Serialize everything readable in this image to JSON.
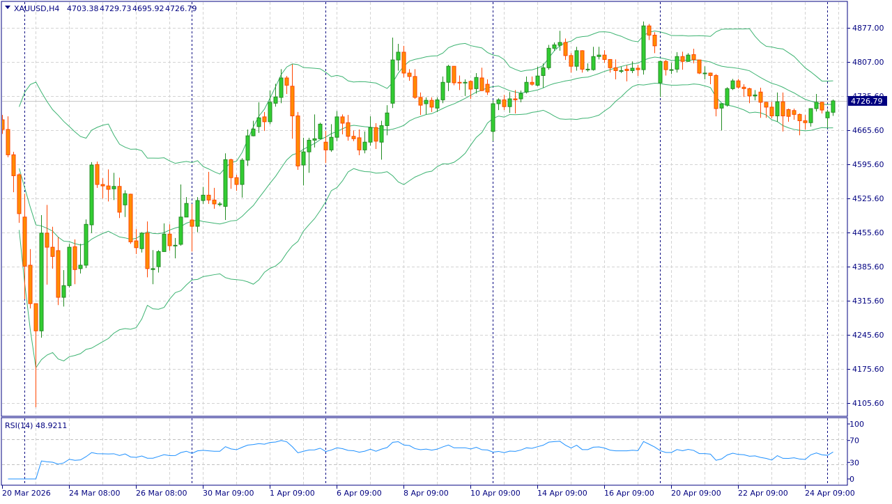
{
  "header": {
    "symbol": "XAUUSD,H4",
    "open": "4703.38",
    "high": "4729.73",
    "low": "4695.92",
    "close": "4726.79"
  },
  "current_price_label": "4726.79",
  "price_axis": {
    "labels": [
      "4877.00",
      "4807.00",
      "4735.60",
      "4665.60",
      "4595.60",
      "4525.60",
      "4455.60",
      "4385.60",
      "4315.60",
      "4245.60",
      "4175.60",
      "4105.60"
    ]
  },
  "time_axis": {
    "labels": [
      "20 Mar 2026",
      "24 Mar 08:00",
      "26 Mar 08:00",
      "30 Mar 09:00",
      "1 Apr 09:00",
      "6 Apr 09:00",
      "8 Apr 09:00",
      "10 Apr 09:00",
      "14 Apr 09:00",
      "16 Apr 09:00",
      "20 Apr 09:00",
      "22 Apr 09:00",
      "24 Apr 09:00"
    ]
  },
  "rsi": {
    "label": "RSI(14) 48.9211",
    "levels": [
      "100",
      "70",
      "30",
      "0"
    ]
  },
  "colors": {
    "bull": "#32CD32",
    "bull_border": "#228B22",
    "bear": "#FF8C00",
    "bear_border": "#FF4500",
    "bands": "#3CB371",
    "rsi_line": "#1E90FF",
    "axis": "#000080"
  },
  "chart_data": {
    "type": "candlestick",
    "symbol": "XAUUSD",
    "timeframe": "H4",
    "ylim": [
      4105.6,
      4877.0
    ],
    "grid": true,
    "open": [
      4688,
      4668,
      4616,
      4575,
      4488,
      4389,
      4310,
      4254,
      4455,
      4426,
      4419,
      4323,
      4347,
      4427,
      4382,
      4389,
      4472,
      4596,
      4555,
      4552,
      4546,
      4551,
      4513,
      4535,
      4439,
      4423,
      4455,
      4380,
      4386,
      4417,
      4453,
      4429,
      4432,
      4488,
      4482,
      4469,
      4522,
      4533,
      4523,
      4515,
      4510,
      4606,
      4569,
      4555,
      4605,
      4655,
      4674,
      4694,
      4684,
      4722,
      4734,
      4774,
      4757,
      4696,
      4595,
      4622,
      4646,
      4649,
      4642,
      4626,
      4652,
      4694,
      4682,
      4654,
      4651,
      4626,
      4642,
      4672,
      4642,
      4676,
      4722,
      4811,
      4827,
      4784,
      4777,
      4734,
      4721,
      4728,
      4712,
      4729,
      4765,
      4798,
      4765,
      4764,
      4767,
      4752,
      4774,
      4761,
      4664,
      4721,
      4729,
      4715,
      4731,
      4731,
      4745,
      4765,
      4759,
      4779,
      4795,
      4835,
      4841,
      4847,
      4820,
      4798,
      4830,
      4792,
      4791,
      4818,
      4821,
      4812,
      4795,
      4789,
      4792,
      4789,
      4794,
      4791,
      4881,
      4862,
      4764,
      4808,
      4791,
      4792,
      4818,
      4808,
      4822,
      4811,
      4784,
      4784,
      4779,
      4712,
      4718,
      4752,
      4768,
      4755,
      4752,
      4737,
      4745,
      4724,
      4714,
      4696,
      4725,
      4709,
      4707,
      4699,
      4686,
      4682,
      4711,
      4724,
      4692,
      4703.38
    ],
    "high": [
      4698,
      4695,
      4622,
      4578,
      4536,
      4422,
      4310,
      4492,
      4513,
      4468,
      4447,
      4379,
      4433,
      4442,
      4433,
      4483,
      4601,
      4602,
      4568,
      4586,
      4579,
      4569,
      4543,
      4536,
      4463,
      4457,
      4479,
      4420,
      4420,
      4475,
      4473,
      4445,
      4555,
      4529,
      4515,
      4529,
      4550,
      4581,
      4548,
      4519,
      4619,
      4608,
      4575,
      4609,
      4668,
      4686,
      4724,
      4704,
      4748,
      4762,
      4792,
      4778,
      4802,
      4704,
      4651,
      4651,
      4699,
      4682,
      4665,
      4679,
      4706,
      4699,
      4698,
      4666,
      4668,
      4664,
      4695,
      4681,
      4686,
      4718,
      4857,
      4844,
      4840,
      4792,
      4792,
      4744,
      4734,
      4734,
      4734,
      4777,
      4801,
      4798,
      4779,
      4771,
      4769,
      4784,
      4795,
      4771,
      4728,
      4732,
      4739,
      4745,
      4749,
      4748,
      4777,
      4777,
      4797,
      4804,
      4842,
      4847,
      4871,
      4855,
      4825,
      4838,
      4831,
      4804,
      4838,
      4838,
      4831,
      4812,
      4812,
      4797,
      4800,
      4808,
      4801,
      4890,
      4885,
      4868,
      4810,
      4811,
      4805,
      4827,
      4828,
      4825,
      4834,
      4811,
      4798,
      4785,
      4782,
      4721,
      4755,
      4772,
      4772,
      4761,
      4754,
      4749,
      4754,
      4725,
      4725,
      4744,
      4744,
      4711,
      4711,
      4701,
      4698,
      4711,
      4741,
      4725,
      4709,
      4729.73
    ],
    "low": [
      4659,
      4611,
      4539,
      4476,
      4319,
      4300,
      4097,
      4240,
      4349,
      4382,
      4307,
      4304,
      4343,
      4350,
      4372,
      4383,
      4455,
      4548,
      4526,
      4520,
      4523,
      4486,
      4488,
      4433,
      4412,
      4415,
      4364,
      4350,
      4374,
      4417,
      4419,
      4403,
      4429,
      4488,
      4417,
      4457,
      4515,
      4515,
      4505,
      4510,
      4482,
      4546,
      4542,
      4528,
      4593,
      4654,
      4661,
      4665,
      4679,
      4715,
      4722,
      4741,
      4649,
      4585,
      4553,
      4579,
      4631,
      4648,
      4599,
      4622,
      4644,
      4658,
      4645,
      4644,
      4615,
      4619,
      4635,
      4628,
      4606,
      4656,
      4712,
      4789,
      4775,
      4768,
      4731,
      4698,
      4699,
      4704,
      4704,
      4722,
      4747,
      4759,
      4749,
      4737,
      4731,
      4742,
      4747,
      4739,
      4644,
      4708,
      4708,
      4702,
      4701,
      4724,
      4742,
      4758,
      4757,
      4754,
      4791,
      4830,
      4830,
      4811,
      4785,
      4789,
      4785,
      4787,
      4789,
      4812,
      4805,
      4785,
      4771,
      4784,
      4767,
      4784,
      4778,
      4781,
      4852,
      4825,
      4735,
      4779,
      4782,
      4785,
      4791,
      4807,
      4804,
      4782,
      4771,
      4761,
      4695,
      4666,
      4715,
      4749,
      4752,
      4735,
      4722,
      4728,
      4692,
      4692,
      4691,
      4684,
      4664,
      4684,
      4688,
      4656,
      4668,
      4674,
      4705,
      4701,
      4672,
      4695.92
    ],
    "close": [
      4668,
      4616,
      4573,
      4495,
      4387,
      4310,
      4254,
      4455,
      4426,
      4407,
      4323,
      4347,
      4426,
      4380,
      4389,
      4473,
      4595,
      4555,
      4552,
      4545,
      4551,
      4498,
      4536,
      4437,
      4425,
      4455,
      4382,
      4382,
      4417,
      4453,
      4429,
      4430,
      4488,
      4516,
      4469,
      4522,
      4533,
      4523,
      4515,
      4515,
      4606,
      4569,
      4555,
      4605,
      4655,
      4669,
      4692,
      4684,
      4724,
      4735,
      4774,
      4759,
      4696,
      4593,
      4622,
      4646,
      4649,
      4679,
      4626,
      4652,
      4694,
      4681,
      4654,
      4649,
      4626,
      4642,
      4672,
      4644,
      4676,
      4702,
      4811,
      4827,
      4784,
      4777,
      4734,
      4718,
      4728,
      4714,
      4729,
      4765,
      4798,
      4764,
      4764,
      4765,
      4751,
      4775,
      4748,
      4745,
      4721,
      4729,
      4715,
      4731,
      4729,
      4742,
      4765,
      4761,
      4778,
      4795,
      4835,
      4842,
      4847,
      4820,
      4798,
      4830,
      4792,
      4792,
      4818,
      4821,
      4812,
      4795,
      4789,
      4789,
      4789,
      4794,
      4791,
      4881,
      4862,
      4840,
      4808,
      4791,
      4791,
      4818,
      4808,
      4821,
      4812,
      4784,
      4784,
      4779,
      4711,
      4721,
      4752,
      4768,
      4755,
      4752,
      4737,
      4739,
      4724,
      4714,
      4696,
      4725,
      4696,
      4695,
      4699,
      4686,
      4682,
      4711,
      4724,
      4708,
      4704,
      4726.79
    ]
  }
}
